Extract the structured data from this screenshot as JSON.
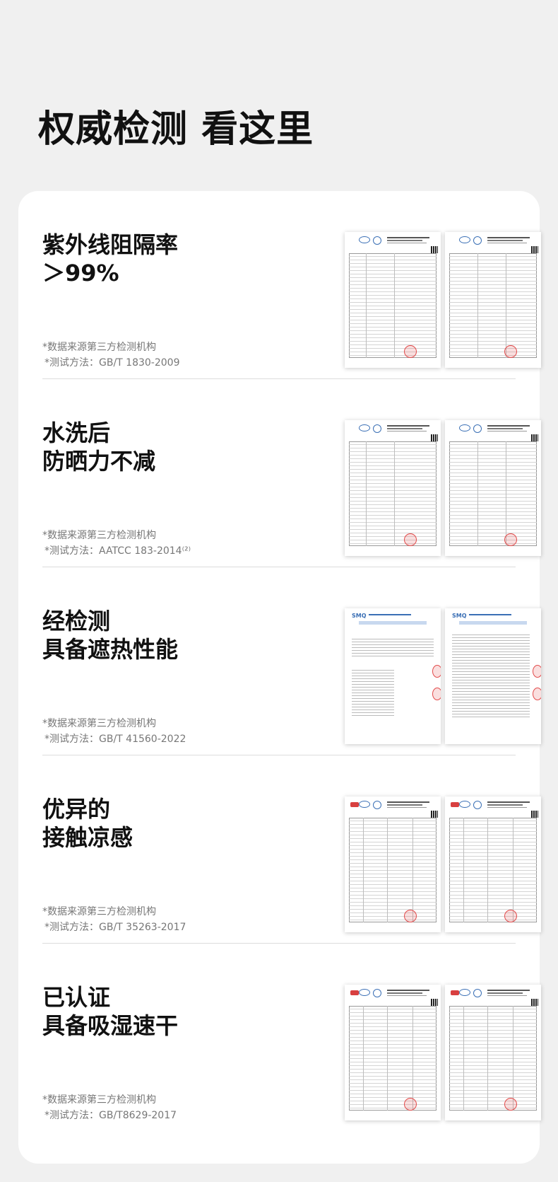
{
  "page": {
    "title": "权威检测 看这里"
  },
  "sections": [
    {
      "heading": [
        "紫外线阻隔率",
        "＞99%"
      ],
      "source_note": "*数据来源第三方检测机构",
      "method_note": "*测试方法：GB/T 1830-2009"
    },
    {
      "heading": [
        "水洗后",
        "防晒力不减"
      ],
      "source_note": "*数据来源第三方检测机构",
      "method_note": "*测试方法：AATCC 183-2014⁽²⁾"
    },
    {
      "heading": [
        "经检测",
        "具备遮热性能"
      ],
      "source_note": "*数据来源第三方检测机构",
      "method_note": "*测试方法：GB/T 41560-2022"
    },
    {
      "heading": [
        "优异的",
        "接触凉感"
      ],
      "source_note": "*数据来源第三方检测机构",
      "method_note": "*测试方法：GB/T 35263-2017"
    },
    {
      "heading": [
        "已认证",
        "具备吸湿速干"
      ],
      "source_note": "*数据来源第三方检测机构",
      "method_note": "*测试方法：GB/T8629-2017"
    }
  ],
  "colors": {
    "background": "#f0f0f0",
    "card": "#ffffff",
    "heading": "#111111",
    "note": "#777777",
    "stamp": "#e24b4b",
    "logo": "#3a6fb5"
  }
}
